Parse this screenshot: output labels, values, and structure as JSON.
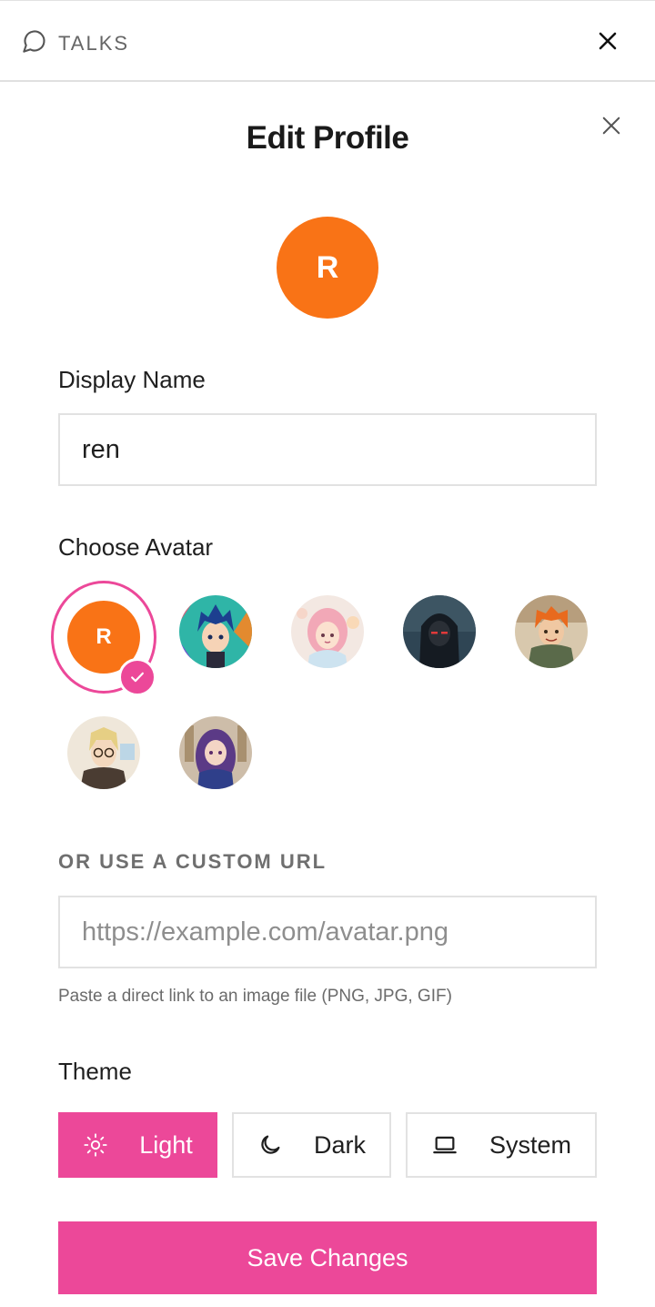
{
  "app": {
    "name": "TALKS"
  },
  "modal": {
    "title": "Edit Profile",
    "avatar_initial": "R"
  },
  "display_name": {
    "label": "Display Name",
    "value": "ren"
  },
  "avatar_picker": {
    "label": "Choose Avatar",
    "selected_initial": "R",
    "options": [
      {
        "icon": "avatar-initial-r",
        "selected": true
      },
      {
        "icon": "anime-boy-blue-hair-avatar",
        "selected": false
      },
      {
        "icon": "anime-girl-pink-hair-avatar",
        "selected": false
      },
      {
        "icon": "hooded-figure-avatar",
        "selected": false
      },
      {
        "icon": "anime-boy-orange-hair-avatar",
        "selected": false
      },
      {
        "icon": "anime-boy-glasses-avatar",
        "selected": false
      },
      {
        "icon": "anime-girl-purple-hair-avatar",
        "selected": false
      }
    ]
  },
  "custom_url": {
    "label": "OR USE A CUSTOM URL",
    "placeholder": "https://example.com/avatar.png",
    "value": "",
    "hint": "Paste a direct link to an image file (PNG, JPG, GIF)"
  },
  "theme": {
    "label": "Theme",
    "options": [
      {
        "label": "Light",
        "icon": "sun-icon",
        "active": true
      },
      {
        "label": "Dark",
        "icon": "moon-icon",
        "active": false
      },
      {
        "label": "System",
        "icon": "laptop-icon",
        "active": false
      }
    ]
  },
  "actions": {
    "save_label": "Save Changes"
  },
  "colors": {
    "accent": "#ec4899",
    "avatar_bg": "#f97316"
  }
}
